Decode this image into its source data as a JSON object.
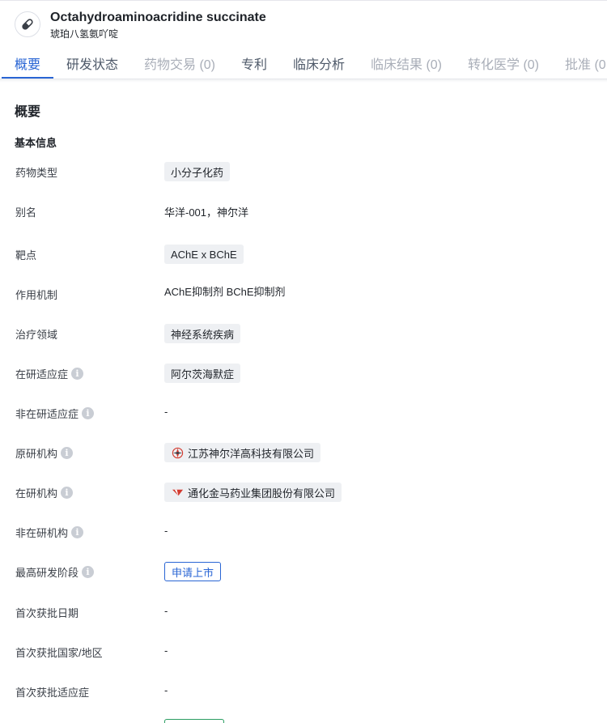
{
  "header": {
    "title": "Octahydroaminoacridine succinate",
    "subtitle": "琥珀八氢氨吖啶",
    "avatar_icon": "pill-icon"
  },
  "tabs": [
    {
      "label": "概要",
      "state": "active"
    },
    {
      "label": "研发状态",
      "state": "enabled"
    },
    {
      "label": "药物交易 (0)",
      "state": "disabled"
    },
    {
      "label": "专利",
      "state": "enabled"
    },
    {
      "label": "临床分析",
      "state": "enabled"
    },
    {
      "label": "临床结果 (0)",
      "state": "disabled"
    },
    {
      "label": "转化医学 (0)",
      "state": "disabled"
    },
    {
      "label": "批准 (0",
      "state": "disabled"
    }
  ],
  "overview": {
    "section_title": "概要",
    "basic_info_title": "基本信息",
    "rows": [
      {
        "label": "药物类型",
        "value": "小分子化药"
      },
      {
        "label": "别名",
        "value": "华洋-001，神尔洋"
      },
      {
        "label": "靶点",
        "value": "AChE x BChE"
      },
      {
        "label": "作用机制",
        "value": "AChE抑制剂  BChE抑制剂"
      },
      {
        "label": "治疗领域",
        "value": "神经系统疾病"
      },
      {
        "label": "在研适应症",
        "value": "阿尔茨海默症"
      },
      {
        "label": "非在研适应症",
        "value": "-"
      },
      {
        "label": "原研机构",
        "value": "江苏神尔洋高科技有限公司"
      },
      {
        "label": "在研机构",
        "value": "通化金马药业集团股份有限公司"
      },
      {
        "label": "非在研机构",
        "value": "-"
      },
      {
        "label": "最高研发阶段",
        "value": "申请上市"
      },
      {
        "label": "首次获批日期",
        "value": "-"
      },
      {
        "label": "首次获批国家/地区",
        "value": "-"
      },
      {
        "label": "首次获批适应症",
        "value": "-"
      }
    ]
  },
  "colors": {
    "accent": "#2965d4",
    "tag_bg": "#eef0f3",
    "info_icon": "#c9cdd4",
    "logo_red": "#d23a2f"
  }
}
